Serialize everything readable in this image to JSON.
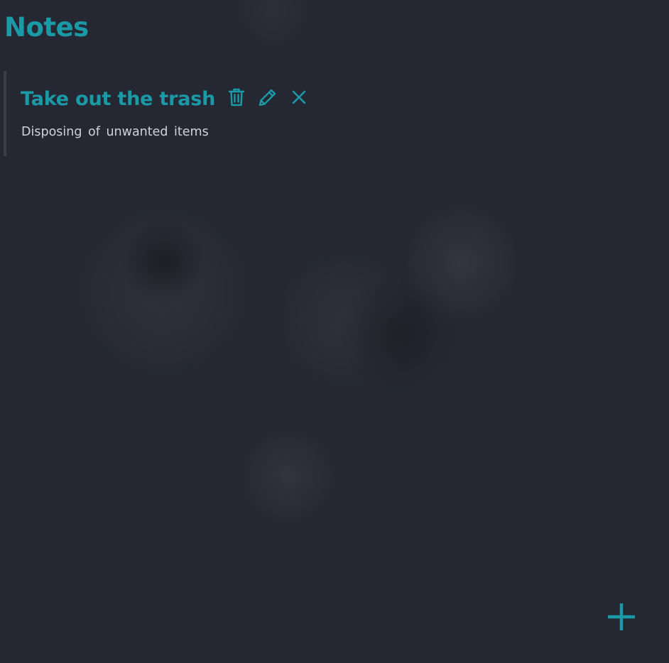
{
  "page": {
    "title": "Notes"
  },
  "notes": [
    {
      "title": "Take out the trash",
      "description": "Disposing of unwanted items"
    }
  ],
  "icons": {
    "delete": "trash-icon",
    "edit": "pencil-icon",
    "close": "close-icon",
    "add": "plus-icon"
  },
  "colors": {
    "accent": "#1a9aa6",
    "background": "#252832",
    "text": "#cfd2d8",
    "card_border": "#3b3e48"
  }
}
